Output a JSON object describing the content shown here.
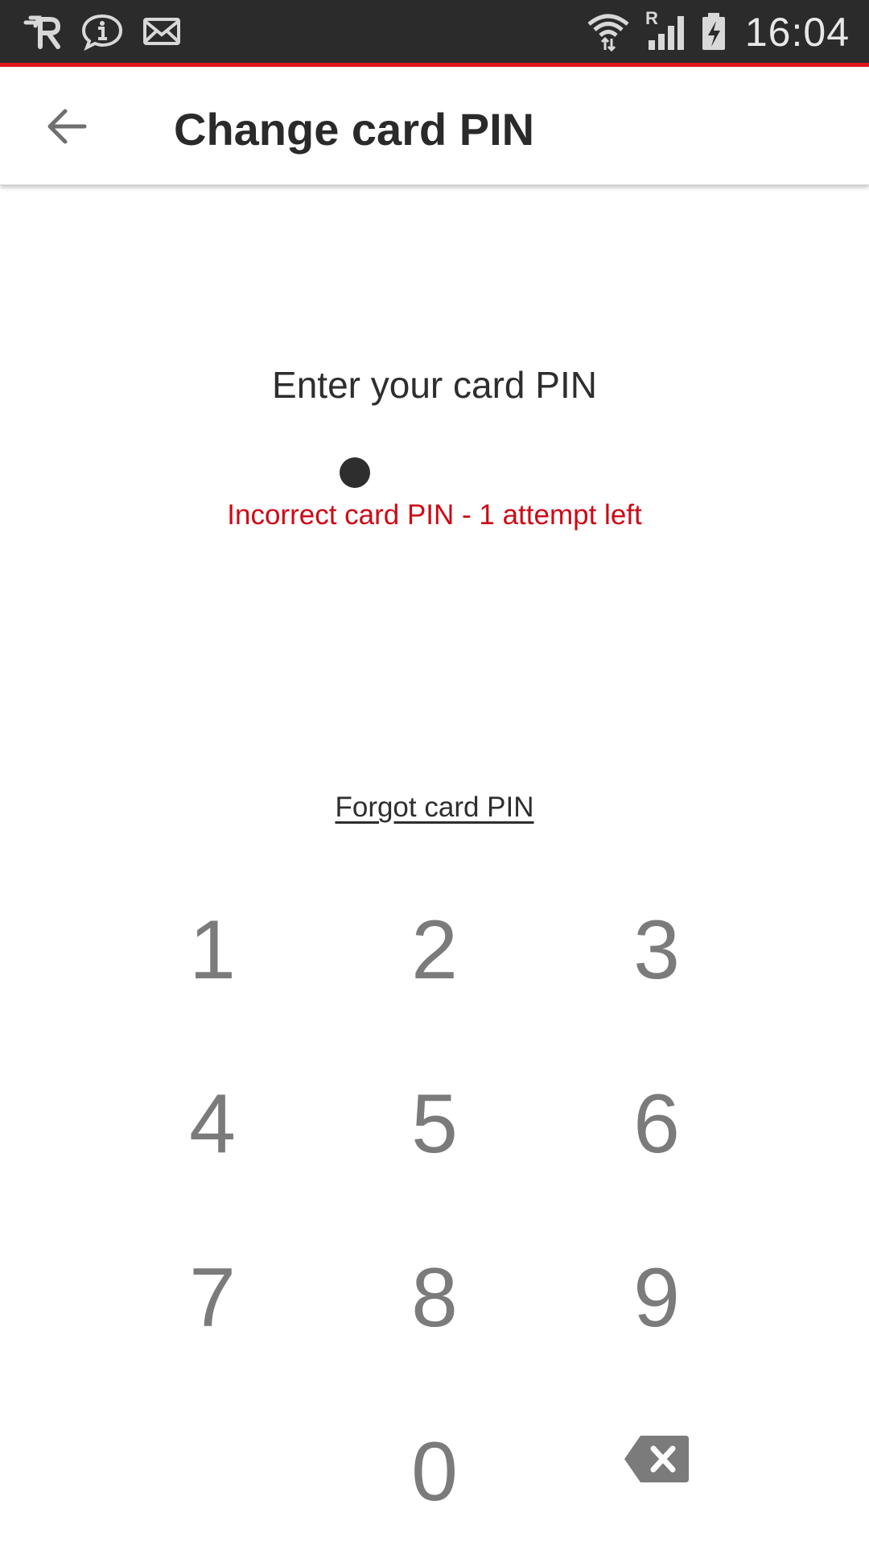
{
  "status_bar": {
    "time": "16:04",
    "left_icons": [
      "app-notification-icon",
      "info-chat-icon",
      "mail-icon"
    ],
    "right_icons": [
      "wifi-icon",
      "cell-signal-roaming-icon",
      "battery-charging-icon"
    ],
    "roaming_indicator": "R"
  },
  "toolbar": {
    "title": "Change card PIN",
    "back_icon": "arrow-back-icon"
  },
  "pin_entry": {
    "prompt": "Enter your card PIN",
    "digits_entered": 1,
    "error_message": "Incorrect card PIN - 1 attempt left"
  },
  "forgot_link": "Forgot card PIN",
  "keypad": {
    "keys": [
      "1",
      "2",
      "3",
      "4",
      "5",
      "6",
      "7",
      "8",
      "9",
      "0"
    ],
    "delete_icon": "backspace-icon"
  },
  "colors": {
    "accent": "#e0161b",
    "error": "#cc0a16",
    "status_bar": "#2b2b2b",
    "key_text": "#7b7b7b",
    "title_text": "#2a2a2a"
  }
}
